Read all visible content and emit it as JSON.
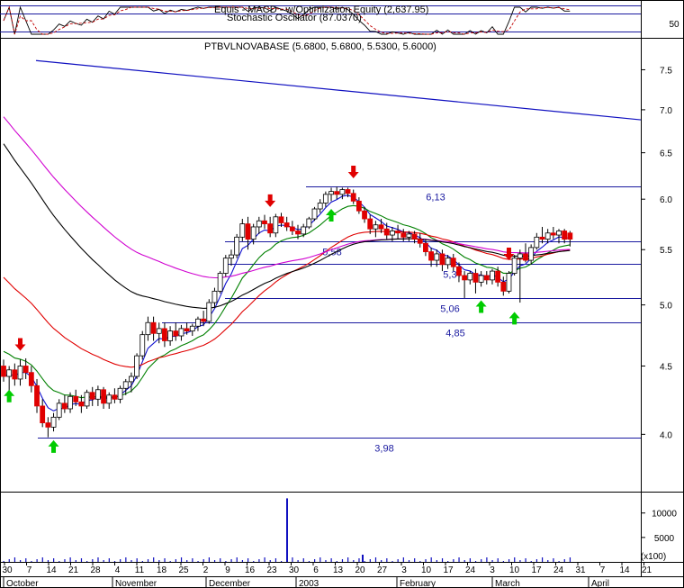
{
  "chart_data": {
    "type": "candlestick",
    "indicator_title": "Equis - MACD - w/Optimization Equity (2,637.95)",
    "oscillator_title": "Stochastic Oscillator (87.0370)",
    "oscillator_ticks": [
      {
        "v": 50,
        "label": "50"
      }
    ],
    "price_title": "PTBVLNOVABASE (5.6800, 5.6800, 5.5300, 5.6000)",
    "y_ticks": [
      {
        "v": 4.0,
        "label": "4.0"
      },
      {
        "v": 4.5,
        "label": "4.5"
      },
      {
        "v": 5.0,
        "label": "5.0"
      },
      {
        "v": 5.5,
        "label": "5.5"
      },
      {
        "v": 6.0,
        "label": "6.0"
      },
      {
        "v": 6.5,
        "label": "6.5"
      },
      {
        "v": 7.0,
        "label": "7.0"
      },
      {
        "v": 7.5,
        "label": "7.5"
      }
    ],
    "volume_ticks": [
      {
        "v": 5000,
        "label": "5000"
      },
      {
        "v": 10000,
        "label": "10000"
      }
    ],
    "volume_multiplier": "(x100)",
    "horizontal_levels": [
      {
        "v": 6.13,
        "label": "6,13"
      },
      {
        "v": 5.58,
        "label": "5,58"
      },
      {
        "v": 5.37,
        "label": "5,37"
      },
      {
        "v": 5.06,
        "label": "5,06"
      },
      {
        "v": 4.85,
        "label": "4,85"
      },
      {
        "v": 3.98,
        "label": "3,98"
      }
    ],
    "x_day_ticks": [
      "30",
      "7",
      "14",
      "21",
      "28",
      "4",
      "11",
      "18",
      "25",
      "2",
      "9",
      "16",
      "23",
      "30",
      "6",
      "13",
      "20",
      "27",
      "3",
      "10",
      "17",
      "24",
      "3",
      "10",
      "17",
      "24",
      "31",
      "7",
      "14",
      "21"
    ],
    "month_labels": [
      "October",
      "November",
      "December",
      "2003",
      "February",
      "March",
      "April"
    ],
    "candles": [
      {
        "o": 4.5,
        "h": 4.55,
        "l": 4.38,
        "c": 4.42
      },
      {
        "o": 4.42,
        "h": 4.5,
        "l": 4.3,
        "c": 4.47
      },
      {
        "o": 4.47,
        "h": 4.52,
        "l": 4.35,
        "c": 4.4
      },
      {
        "o": 4.4,
        "h": 4.55,
        "l": 4.35,
        "c": 4.5
      },
      {
        "o": 4.5,
        "h": 4.56,
        "l": 4.4,
        "c": 4.45
      },
      {
        "o": 4.45,
        "h": 4.5,
        "l": 4.3,
        "c": 4.35
      },
      {
        "o": 4.35,
        "h": 4.4,
        "l": 4.15,
        "c": 4.2
      },
      {
        "o": 4.2,
        "h": 4.25,
        "l": 4.05,
        "c": 4.08
      },
      {
        "o": 4.08,
        "h": 4.12,
        "l": 3.98,
        "c": 4.05
      },
      {
        "o": 4.05,
        "h": 4.15,
        "l": 4.02,
        "c": 4.12
      },
      {
        "o": 4.12,
        "h": 4.25,
        "l": 4.1,
        "c": 4.22
      },
      {
        "o": 4.22,
        "h": 4.28,
        "l": 4.15,
        "c": 4.18
      },
      {
        "o": 4.18,
        "h": 4.3,
        "l": 4.15,
        "c": 4.27
      },
      {
        "o": 4.27,
        "h": 4.32,
        "l": 4.2,
        "c": 4.23
      },
      {
        "o": 4.23,
        "h": 4.28,
        "l": 4.15,
        "c": 4.2
      },
      {
        "o": 4.2,
        "h": 4.32,
        "l": 4.18,
        "c": 4.3
      },
      {
        "o": 4.3,
        "h": 4.34,
        "l": 4.2,
        "c": 4.25
      },
      {
        "o": 4.25,
        "h": 4.35,
        "l": 4.2,
        "c": 4.32
      },
      {
        "o": 4.32,
        "h": 4.34,
        "l": 4.18,
        "c": 4.22
      },
      {
        "o": 4.22,
        "h": 4.3,
        "l": 4.18,
        "c": 4.28
      },
      {
        "o": 4.28,
        "h": 4.33,
        "l": 4.22,
        "c": 4.25
      },
      {
        "o": 4.25,
        "h": 4.35,
        "l": 4.22,
        "c": 4.33
      },
      {
        "o": 4.33,
        "h": 4.4,
        "l": 4.28,
        "c": 4.38
      },
      {
        "o": 4.38,
        "h": 4.45,
        "l": 4.3,
        "c": 4.42
      },
      {
        "o": 4.42,
        "h": 4.6,
        "l": 4.4,
        "c": 4.58
      },
      {
        "o": 4.58,
        "h": 4.78,
        "l": 4.55,
        "c": 4.75
      },
      {
        "o": 4.75,
        "h": 4.9,
        "l": 4.7,
        "c": 4.85
      },
      {
        "o": 4.85,
        "h": 4.9,
        "l": 4.7,
        "c": 4.76
      },
      {
        "o": 4.76,
        "h": 4.85,
        "l": 4.68,
        "c": 4.8
      },
      {
        "o": 4.8,
        "h": 4.85,
        "l": 4.65,
        "c": 4.7
      },
      {
        "o": 4.7,
        "h": 4.82,
        "l": 4.66,
        "c": 4.78
      },
      {
        "o": 4.78,
        "h": 4.85,
        "l": 4.7,
        "c": 4.74
      },
      {
        "o": 4.74,
        "h": 4.83,
        "l": 4.7,
        "c": 4.8
      },
      {
        "o": 4.8,
        "h": 4.85,
        "l": 4.75,
        "c": 4.78
      },
      {
        "o": 4.78,
        "h": 4.84,
        "l": 4.74,
        "c": 4.82
      },
      {
        "o": 4.82,
        "h": 4.9,
        "l": 4.78,
        "c": 4.88
      },
      {
        "o": 4.88,
        "h": 4.95,
        "l": 4.82,
        "c": 4.86
      },
      {
        "o": 4.86,
        "h": 5.05,
        "l": 4.84,
        "c": 5.02
      },
      {
        "o": 5.02,
        "h": 5.15,
        "l": 4.98,
        "c": 5.12
      },
      {
        "o": 5.12,
        "h": 5.3,
        "l": 5.1,
        "c": 5.28
      },
      {
        "o": 5.28,
        "h": 5.45,
        "l": 5.25,
        "c": 5.42
      },
      {
        "o": 5.42,
        "h": 5.5,
        "l": 5.35,
        "c": 5.45
      },
      {
        "o": 5.45,
        "h": 5.65,
        "l": 5.42,
        "c": 5.62
      },
      {
        "o": 5.62,
        "h": 5.8,
        "l": 5.58,
        "c": 5.75
      },
      {
        "o": 5.75,
        "h": 5.82,
        "l": 5.5,
        "c": 5.6
      },
      {
        "o": 5.6,
        "h": 5.75,
        "l": 5.55,
        "c": 5.72
      },
      {
        "o": 5.72,
        "h": 5.82,
        "l": 5.65,
        "c": 5.78
      },
      {
        "o": 5.78,
        "h": 5.84,
        "l": 5.7,
        "c": 5.75
      },
      {
        "o": 5.75,
        "h": 5.82,
        "l": 5.62,
        "c": 5.66
      },
      {
        "o": 5.66,
        "h": 5.85,
        "l": 5.62,
        "c": 5.82
      },
      {
        "o": 5.82,
        "h": 5.86,
        "l": 5.72,
        "c": 5.76
      },
      {
        "o": 5.76,
        "h": 5.82,
        "l": 5.68,
        "c": 5.72
      },
      {
        "o": 5.72,
        "h": 5.78,
        "l": 5.64,
        "c": 5.68
      },
      {
        "o": 5.68,
        "h": 5.74,
        "l": 5.6,
        "c": 5.65
      },
      {
        "o": 5.65,
        "h": 5.75,
        "l": 5.62,
        "c": 5.72
      },
      {
        "o": 5.72,
        "h": 5.82,
        "l": 5.7,
        "c": 5.8
      },
      {
        "o": 5.8,
        "h": 5.92,
        "l": 5.78,
        "c": 5.9
      },
      {
        "o": 5.9,
        "h": 6.0,
        "l": 5.86,
        "c": 5.96
      },
      {
        "o": 5.96,
        "h": 6.08,
        "l": 5.92,
        "c": 6.05
      },
      {
        "o": 6.05,
        "h": 6.12,
        "l": 5.98,
        "c": 6.08
      },
      {
        "o": 6.08,
        "h": 6.13,
        "l": 6.0,
        "c": 6.05
      },
      {
        "o": 6.05,
        "h": 6.12,
        "l": 6.0,
        "c": 6.1
      },
      {
        "o": 6.1,
        "h": 6.12,
        "l": 6.02,
        "c": 6.06
      },
      {
        "o": 6.06,
        "h": 6.1,
        "l": 5.95,
        "c": 5.98
      },
      {
        "o": 5.98,
        "h": 6.02,
        "l": 5.85,
        "c": 5.88
      },
      {
        "o": 5.88,
        "h": 5.92,
        "l": 5.76,
        "c": 5.8
      },
      {
        "o": 5.8,
        "h": 5.84,
        "l": 5.65,
        "c": 5.7
      },
      {
        "o": 5.7,
        "h": 5.78,
        "l": 5.62,
        "c": 5.74
      },
      {
        "o": 5.74,
        "h": 5.8,
        "l": 5.66,
        "c": 5.7
      },
      {
        "o": 5.7,
        "h": 5.76,
        "l": 5.6,
        "c": 5.64
      },
      {
        "o": 5.64,
        "h": 5.72,
        "l": 5.58,
        "c": 5.68
      },
      {
        "o": 5.68,
        "h": 5.74,
        "l": 5.6,
        "c": 5.66
      },
      {
        "o": 5.66,
        "h": 5.7,
        "l": 5.58,
        "c": 5.62
      },
      {
        "o": 5.62,
        "h": 5.68,
        "l": 5.58,
        "c": 5.65
      },
      {
        "o": 5.65,
        "h": 5.68,
        "l": 5.56,
        "c": 5.6
      },
      {
        "o": 5.6,
        "h": 5.66,
        "l": 5.52,
        "c": 5.56
      },
      {
        "o": 5.56,
        "h": 5.6,
        "l": 5.44,
        "c": 5.48
      },
      {
        "o": 5.48,
        "h": 5.52,
        "l": 5.34,
        "c": 5.4
      },
      {
        "o": 5.4,
        "h": 5.5,
        "l": 5.34,
        "c": 5.46
      },
      {
        "o": 5.46,
        "h": 5.5,
        "l": 5.3,
        "c": 5.36
      },
      {
        "o": 5.36,
        "h": 5.45,
        "l": 5.32,
        "c": 5.42
      },
      {
        "o": 5.42,
        "h": 5.46,
        "l": 5.3,
        "c": 5.34
      },
      {
        "o": 5.34,
        "h": 5.38,
        "l": 5.2,
        "c": 5.26
      },
      {
        "o": 5.26,
        "h": 5.3,
        "l": 5.06,
        "c": 5.22
      },
      {
        "o": 5.22,
        "h": 5.3,
        "l": 5.18,
        "c": 5.28
      },
      {
        "o": 5.28,
        "h": 5.32,
        "l": 5.1,
        "c": 5.2
      },
      {
        "o": 5.2,
        "h": 5.3,
        "l": 5.16,
        "c": 5.26
      },
      {
        "o": 5.26,
        "h": 5.3,
        "l": 5.18,
        "c": 5.22
      },
      {
        "o": 5.22,
        "h": 5.32,
        "l": 5.18,
        "c": 5.3
      },
      {
        "o": 5.3,
        "h": 5.34,
        "l": 5.16,
        "c": 5.2
      },
      {
        "o": 5.2,
        "h": 5.25,
        "l": 5.08,
        "c": 5.12
      },
      {
        "o": 5.12,
        "h": 5.3,
        "l": 5.1,
        "c": 5.28
      },
      {
        "o": 5.28,
        "h": 5.45,
        "l": 5.26,
        "c": 5.42
      },
      {
        "o": 5.42,
        "h": 5.5,
        "l": 5.02,
        "c": 5.46
      },
      {
        "o": 5.46,
        "h": 5.56,
        "l": 5.38,
        "c": 5.4
      },
      {
        "o": 5.4,
        "h": 5.55,
        "l": 5.36,
        "c": 5.52
      },
      {
        "o": 5.52,
        "h": 5.66,
        "l": 5.5,
        "c": 5.62
      },
      {
        "o": 5.62,
        "h": 5.72,
        "l": 5.56,
        "c": 5.6
      },
      {
        "o": 5.6,
        "h": 5.7,
        "l": 5.56,
        "c": 5.66
      },
      {
        "o": 5.66,
        "h": 5.72,
        "l": 5.6,
        "c": 5.64
      },
      {
        "o": 5.64,
        "h": 5.7,
        "l": 5.56,
        "c": 5.68
      },
      {
        "o": 5.68,
        "h": 5.7,
        "l": 5.56,
        "c": 5.6
      },
      {
        "o": 5.66,
        "h": 5.68,
        "l": 5.53,
        "c": 5.6
      }
    ],
    "volume_spike": {
      "value": 13000,
      "position": 0.45
    },
    "arrows_down": [
      {
        "bar": 3,
        "v": 4.62
      },
      {
        "bar": 48,
        "v": 5.92
      },
      {
        "bar": 63,
        "v": 6.22
      },
      {
        "bar": 91,
        "v": 5.4
      }
    ],
    "arrows_up": [
      {
        "bar": 1,
        "v": 4.32
      },
      {
        "bar": 9,
        "v": 3.96
      },
      {
        "bar": 59,
        "v": 5.9
      },
      {
        "bar": 86,
        "v": 5.04
      },
      {
        "bar": 92,
        "v": 4.94
      }
    ],
    "trendline": {
      "v_start": 7.62,
      "v_end": 6.88
    }
  },
  "colors": {
    "up": "#ffffff",
    "down": "#e00000",
    "arrow_down": "#e00000",
    "arrow_up": "#00cc00",
    "level": "#1a1aa0",
    "ma_blue": "#1010d0",
    "ma_green": "#008000",
    "ma_red": "#e00000",
    "ma_magenta": "#d000d0",
    "ma_black": "#000000"
  }
}
